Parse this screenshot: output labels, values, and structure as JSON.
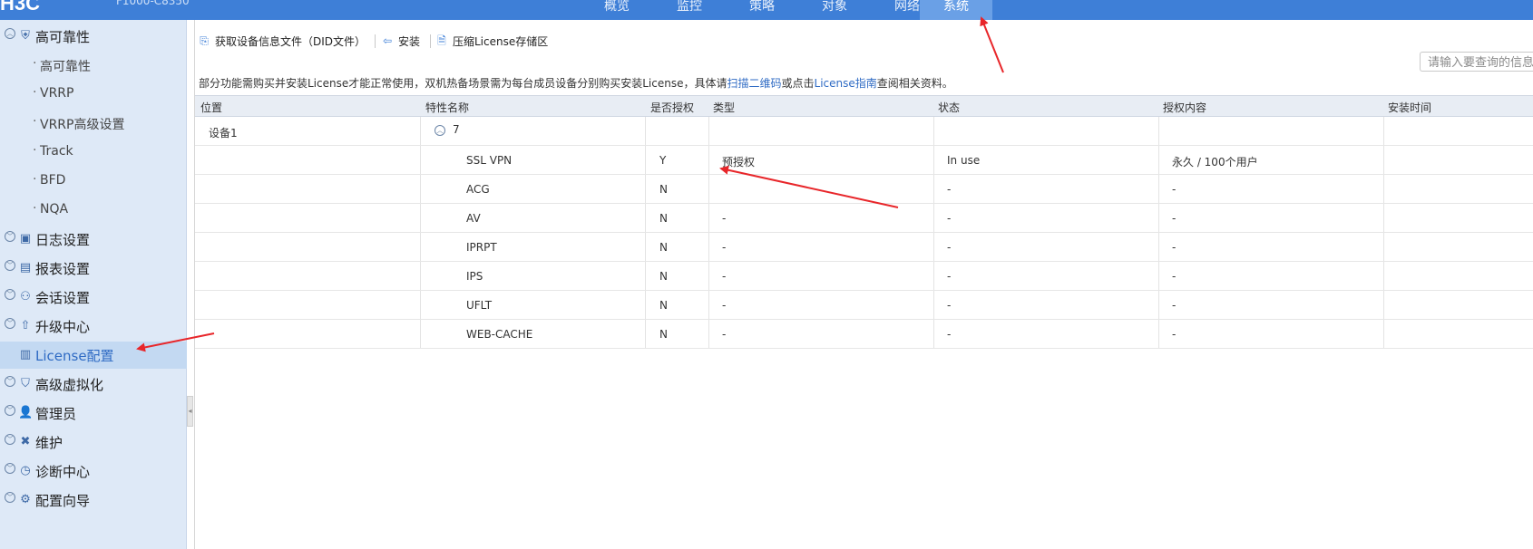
{
  "header": {
    "brand": "H3C",
    "model": "F1000-C8350",
    "tabs": [
      {
        "label": "概览"
      },
      {
        "label": "监控"
      },
      {
        "label": "策略"
      },
      {
        "label": "对象"
      },
      {
        "label": "网络"
      },
      {
        "label": "系统"
      }
    ],
    "active_tab": "系统"
  },
  "sidebar": {
    "group_ha": {
      "label": "高可靠性",
      "icon": "shield-icon",
      "children": [
        {
          "label": "高可靠性"
        },
        {
          "label": "VRRP"
        },
        {
          "label": "VRRP高级设置"
        },
        {
          "label": "Track"
        },
        {
          "label": "BFD"
        },
        {
          "label": "NQA"
        }
      ]
    },
    "items": [
      {
        "label": "日志设置",
        "icon": "log-settings-icon"
      },
      {
        "label": "报表设置",
        "icon": "report-settings-icon"
      },
      {
        "label": "会话设置",
        "icon": "session-icon"
      },
      {
        "label": "升级中心",
        "icon": "upgrade-icon"
      },
      {
        "label": "License配置",
        "icon": "license-icon"
      },
      {
        "label": "高级虚拟化",
        "icon": "virtualization-icon"
      },
      {
        "label": "管理员",
        "icon": "admin-user-icon"
      },
      {
        "label": "维护",
        "icon": "maintenance-tools-icon"
      },
      {
        "label": "诊断中心",
        "icon": "diagnosis-icon"
      },
      {
        "label": "配置向导",
        "icon": "wizard-gear-icon"
      }
    ],
    "active_item": "License配置"
  },
  "toolbar": {
    "get_did_label": "获取设备信息文件（DID文件）",
    "install_label": "安装",
    "compress_label": "压缩License存储区",
    "search_placeholder": "请输入要查询的信息"
  },
  "notice": {
    "text_before": "部分功能需购买并安装License才能正常使用，双机热备场景需为每台成员设备分别购买安装License，具体请",
    "link_qr": "扫描二维码",
    "text_mid": "或点击",
    "link_guide": "License指南",
    "text_after": "查阅相关资料。"
  },
  "table": {
    "headers": {
      "location": "位置",
      "feature": "特性名称",
      "authorized": "是否授权",
      "type": "类型",
      "status": "状态",
      "content": "授权内容",
      "install_time": "安装时间"
    },
    "group": {
      "device": "设备1",
      "count": "7"
    },
    "rows": [
      {
        "feature": "SSL VPN",
        "authorized": "Y",
        "type": "预授权",
        "status": "In use",
        "content": "永久 / 100个用户",
        "install_time": ""
      },
      {
        "feature": "ACG",
        "authorized": "N",
        "type": "",
        "status": "-",
        "content": "-",
        "install_time": ""
      },
      {
        "feature": "AV",
        "authorized": "N",
        "type": "-",
        "status": "-",
        "content": "-",
        "install_time": ""
      },
      {
        "feature": "IPRPT",
        "authorized": "N",
        "type": "-",
        "status": "-",
        "content": "-",
        "install_time": ""
      },
      {
        "feature": "IPS",
        "authorized": "N",
        "type": "-",
        "status": "-",
        "content": "-",
        "install_time": ""
      },
      {
        "feature": "UFLT",
        "authorized": "N",
        "type": "-",
        "status": "-",
        "content": "-",
        "install_time": ""
      },
      {
        "feature": "WEB-CACHE",
        "authorized": "N",
        "type": "-",
        "status": "-",
        "content": "-",
        "install_time": ""
      }
    ]
  },
  "colors": {
    "topbar": "#3e7fd7",
    "sidebar_bg": "#dee9f7",
    "link": "#2f6bc4",
    "annotation_arrow": "#e8262a"
  }
}
